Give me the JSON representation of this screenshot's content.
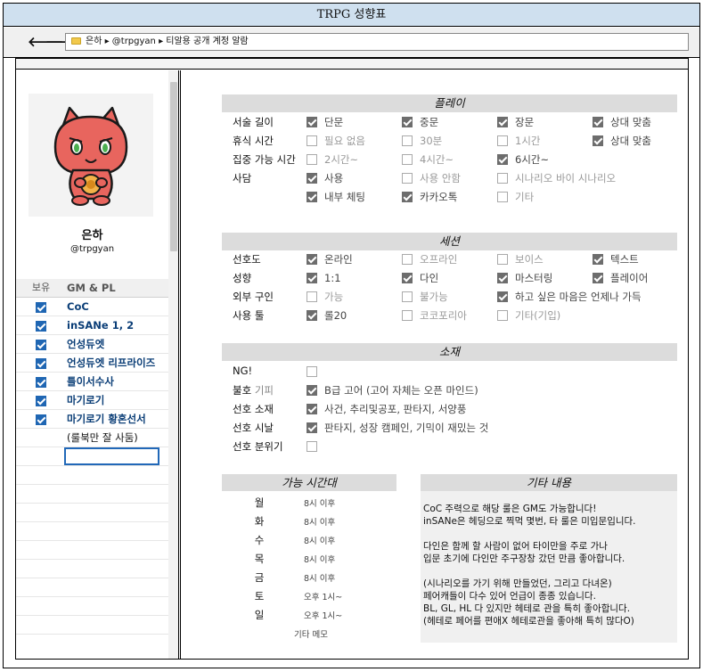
{
  "window": {
    "title": "TRPG 성향표"
  },
  "addressbar": {
    "back": "🡐",
    "forward": "🡒",
    "path": "은하  ▸  @trpgyan  ▸  티알용 공개 계정 알람"
  },
  "profile": {
    "name": "은하",
    "handle": "@trpgyan"
  },
  "gm_table": {
    "col1": "보유",
    "col2": "GM & PL",
    "rows": [
      {
        "label": "CoC",
        "checked": true
      },
      {
        "label": "inSANe 1, 2",
        "checked": true
      },
      {
        "label": "언성듀엣",
        "checked": true
      },
      {
        "label": "언성듀엣 리프라이즈",
        "checked": true
      },
      {
        "label": "틀이서수사",
        "checked": true
      },
      {
        "label": "마기로기",
        "checked": true
      },
      {
        "label": "마기로기 황혼선서",
        "checked": true
      },
      {
        "label": "(룰북만 잘 사둠)",
        "checked": false
      }
    ]
  },
  "sections": {
    "play": {
      "title": "플레이",
      "rows": [
        {
          "label": "서술 길이",
          "options": [
            {
              "text": "단문",
              "on": true
            },
            {
              "text": "중문",
              "on": true
            },
            {
              "text": "장문",
              "on": true
            },
            {
              "text": "상대 맞춤",
              "on": true
            }
          ]
        },
        {
          "label": "휴식 시간",
          "options": [
            {
              "text": "필요 없음",
              "on": false
            },
            {
              "text": "30분",
              "on": false
            },
            {
              "text": "1시간",
              "on": false
            },
            {
              "text": "상대 맞춤",
              "on": true
            }
          ]
        },
        {
          "label": "집중 가능 시간",
          "options": [
            {
              "text": "2시간~",
              "on": false
            },
            {
              "text": "4시간~",
              "on": false
            },
            {
              "text": "6시간~",
              "on": true
            }
          ]
        },
        {
          "label": "사담",
          "options": [
            {
              "text": "사용",
              "on": true
            },
            {
              "text": "사용 안함",
              "on": false
            },
            {
              "text": "시나리오 바이 시나리오",
              "on": false
            }
          ]
        },
        {
          "label": "",
          "options": [
            {
              "text": "내부 체팅",
              "on": true
            },
            {
              "text": "카카오톡",
              "on": true
            },
            {
              "text": "기타",
              "on": false
            }
          ]
        }
      ]
    },
    "session": {
      "title": "세션",
      "rows": [
        {
          "label": "선호도",
          "options": [
            {
              "text": "온라인",
              "on": true
            },
            {
              "text": "오프라인",
              "on": false
            },
            {
              "text": "보이스",
              "on": false
            },
            {
              "text": "텍스트",
              "on": true
            }
          ]
        },
        {
          "label": "성향",
          "options": [
            {
              "text": "1:1",
              "on": true
            },
            {
              "text": "다인",
              "on": true
            },
            {
              "text": "마스터링",
              "on": true
            },
            {
              "text": "플레이어",
              "on": true
            }
          ]
        },
        {
          "label": "외부 구인",
          "options": [
            {
              "text": "가능",
              "on": false
            },
            {
              "text": "불가능",
              "on": false
            },
            {
              "text": "하고 싶은 마음은 언제나 가득",
              "on": true
            }
          ]
        },
        {
          "label": "사용 툴",
          "options": [
            {
              "text": "롤20",
              "on": true
            },
            {
              "text": "코코포리아",
              "on": false
            },
            {
              "text": "기타(기입)",
              "on": false
            }
          ]
        }
      ]
    },
    "material": {
      "title": "소재",
      "rows": [
        {
          "label": "NG!",
          "label_extra": "",
          "on": false,
          "text": ""
        },
        {
          "label": "불호",
          "label_extra": "기피",
          "on": true,
          "text": "B급 고어 (고어 자체는 오픈 마인드)"
        },
        {
          "label": "선호 소재",
          "label_extra": "",
          "on": true,
          "text": "사건, 추리및공포, 판타지, 서양풍"
        },
        {
          "label": "선호 시날",
          "label_extra": "",
          "on": true,
          "text": "판타지, 성장 캠페인, 기믹이 재밌는 것"
        },
        {
          "label": "선호 분위기",
          "label_extra": "",
          "on": false,
          "text": ""
        }
      ]
    }
  },
  "available_time": {
    "title": "가능 시간대",
    "rows": [
      {
        "day": "월",
        "time": "8시 이후"
      },
      {
        "day": "화",
        "time": "8시 이후"
      },
      {
        "day": "수",
        "time": "8시 이후"
      },
      {
        "day": "목",
        "time": "8시 이후"
      },
      {
        "day": "금",
        "time": "8시 이후"
      },
      {
        "day": "토",
        "time": "오후 1시~"
      },
      {
        "day": "일",
        "time": "오후 1시~"
      }
    ],
    "memo": "기타 메모"
  },
  "etc": {
    "title": "기타 내용",
    "body": "CoC 주력으로 해당 룰은 GM도 가능합니다!\ninSANe은 헤딩으로 찍먹 몇번, 타 룰은 미입문입니다.\n\n다인은 함께 할 사람이 없어 타이만을 주로 가나\n입문 초기에 다인만 주구장창 갔던 만큼 좋아합니다.\n\n(시나리오를 가기 위해 만들었던, 그리고 다녀온)\n페어캐들이 다수 있어 언급이 종종 있습니다.\nBL, GL, HL 다 있지만 헤테로 관을 특히 좋아합니다.\n(헤테로 페어를 편애X 헤테로관을 좋아해 특히 많다O)"
  },
  "colors": {
    "titlebar": "#cfe0ef",
    "checked_blue": "#1f66b3",
    "gm_text": "#0b3e77",
    "section_header": "#dcdcdc"
  },
  "icons": {
    "avatar": "red-cat-character-icon",
    "folder": "folder-icon"
  }
}
